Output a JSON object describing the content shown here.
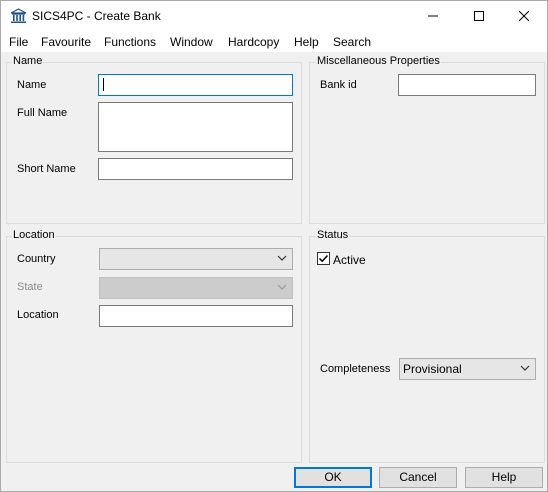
{
  "window": {
    "title": "SICS4PC - Create Bank",
    "icon": "bank-building-icon"
  },
  "menu": [
    "File",
    "Favourite",
    "Functions",
    "Window",
    "Hardcopy",
    "Help",
    "Search"
  ],
  "groups": {
    "name": {
      "label": "Name",
      "fields": {
        "name": {
          "label": "Name",
          "value": ""
        },
        "full_name": {
          "label": "Full Name",
          "value": ""
        },
        "short_name": {
          "label": "Short Name",
          "value": ""
        }
      }
    },
    "misc": {
      "label": "Miscellaneous Properties",
      "fields": {
        "bank_id": {
          "label": "Bank id",
          "value": ""
        }
      }
    },
    "location": {
      "label": "Location",
      "fields": {
        "country": {
          "label": "Country",
          "value": ""
        },
        "state": {
          "label": "State",
          "value": "",
          "disabled": true
        },
        "location": {
          "label": "Location",
          "value": ""
        }
      }
    },
    "status": {
      "label": "Status",
      "active": {
        "label": "Active",
        "checked": true
      },
      "completeness": {
        "label": "Completeness",
        "value": "Provisional"
      }
    }
  },
  "buttons": {
    "ok": "OK",
    "cancel": "Cancel",
    "help": "Help"
  },
  "colors": {
    "focus_border": "#0078d7",
    "panel_bg": "#f0f0f0",
    "disabled_combo_bg": "#cccccc"
  }
}
